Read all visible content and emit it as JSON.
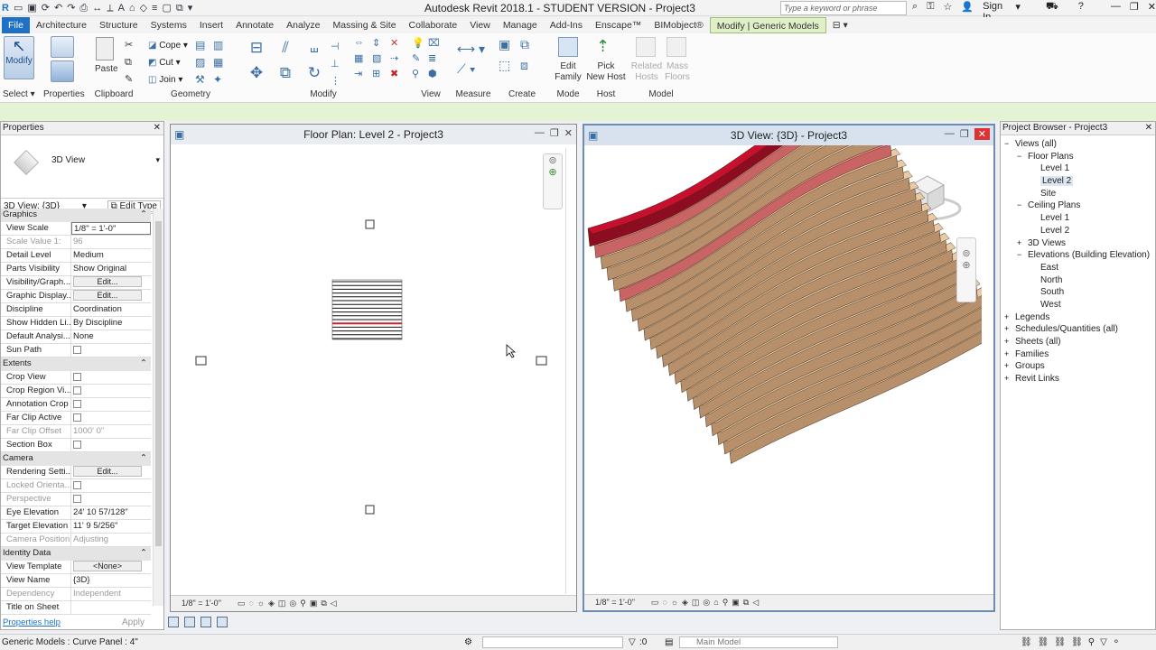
{
  "app": {
    "title": "Autodesk Revit 2018.1 - STUDENT VERSION -   Project3",
    "search_placeholder": "Type a keyword or phrase",
    "sign_in": "Sign In"
  },
  "tabs": [
    "File",
    "Architecture",
    "Structure",
    "Systems",
    "Insert",
    "Annotate",
    "Analyze",
    "Massing & Site",
    "Collaborate",
    "View",
    "Manage",
    "Add-Ins",
    "Enscape™",
    "BIMobject®",
    "Modify | Generic Models"
  ],
  "ribbon": {
    "modify_label": "Modify",
    "select_label": "Select",
    "panels": {
      "properties": "Properties",
      "clipboard": "Clipboard",
      "geometry": "Geometry",
      "modify": "Modify",
      "view": "View",
      "measure": "Measure",
      "create": "Create",
      "mode": "Mode",
      "host": "Host",
      "model": "Model"
    },
    "paste": "Paste",
    "cope": "Cope",
    "cut": "Cut",
    "join": "Join",
    "edit_family": "Edit\nFamily",
    "pick_new_host": "Pick\nNew Host",
    "related_hosts": "Related\nHosts",
    "mass_floors": "Mass\nFloors"
  },
  "properties": {
    "title": "Properties",
    "type": "3D View",
    "view_selector": "3D View: {3D}",
    "edit_type": "Edit Type",
    "groups": [
      {
        "name": "Graphics",
        "rows": [
          [
            "View Scale",
            "1/8\" = 1'-0\""
          ],
          [
            "Scale Value    1:",
            "96"
          ],
          [
            "Detail Level",
            "Medium"
          ],
          [
            "Parts Visibility",
            "Show Original"
          ],
          [
            "Visibility/Graph...",
            "Edit..."
          ],
          [
            "Graphic Display...",
            "Edit..."
          ],
          [
            "Discipline",
            "Coordination"
          ],
          [
            "Show Hidden Li...",
            "By Discipline"
          ],
          [
            "Default Analysi...",
            "None"
          ],
          [
            "Sun Path",
            ""
          ]
        ]
      },
      {
        "name": "Extents",
        "rows": [
          [
            "Crop View",
            ""
          ],
          [
            "Crop Region Vi...",
            ""
          ],
          [
            "Annotation Crop",
            ""
          ],
          [
            "Far Clip Active",
            ""
          ],
          [
            "Far Clip Offset",
            "1000'  0\""
          ],
          [
            "Section Box",
            ""
          ]
        ]
      },
      {
        "name": "Camera",
        "rows": [
          [
            "Rendering Setti...",
            "Edit..."
          ],
          [
            "Locked Orienta...",
            ""
          ],
          [
            "Perspective",
            ""
          ],
          [
            "Eye Elevation",
            "24'  10 57/128\""
          ],
          [
            "Target Elevation",
            "11'  9 5/256\""
          ],
          [
            "Camera Position",
            "Adjusting"
          ]
        ]
      },
      {
        "name": "Identity Data",
        "rows": [
          [
            "View Template",
            "<None>"
          ],
          [
            "View Name",
            "{3D}"
          ],
          [
            "Dependency",
            "Independent"
          ],
          [
            "Title on Sheet",
            ""
          ]
        ]
      }
    ],
    "help": "Properties help",
    "apply": "Apply"
  },
  "floor_view": {
    "title": "Floor Plan: Level 2 - Project3",
    "scale": "1/8\" = 1'-0\""
  },
  "view3d": {
    "title": "3D View: {3D} - Project3",
    "scale": "1/8\" = 1'-0\""
  },
  "browser": {
    "title": "Project Browser - Project3",
    "items": [
      {
        "label": "Views (all)",
        "depth": 0
      },
      {
        "label": "Floor Plans",
        "depth": 1
      },
      {
        "label": "Level 1",
        "depth": 2
      },
      {
        "label": "Level 2",
        "depth": 2
      },
      {
        "label": "Site",
        "depth": 2
      },
      {
        "label": "Ceiling Plans",
        "depth": 1
      },
      {
        "label": "Level 1",
        "depth": 2
      },
      {
        "label": "Level 2",
        "depth": 2
      },
      {
        "label": "3D Views",
        "depth": 1
      },
      {
        "label": "Elevations (Building Elevation)",
        "depth": 1
      },
      {
        "label": "East",
        "depth": 2
      },
      {
        "label": "North",
        "depth": 2
      },
      {
        "label": "South",
        "depth": 2
      },
      {
        "label": "West",
        "depth": 2
      },
      {
        "label": "Legends",
        "depth": 0
      },
      {
        "label": "Schedules/Quantities (all)",
        "depth": 0
      },
      {
        "label": "Sheets (all)",
        "depth": 0
      },
      {
        "label": "Families",
        "depth": 0
      },
      {
        "label": "Groups",
        "depth": 0
      },
      {
        "label": "Revit Links",
        "depth": 0
      }
    ]
  },
  "status": {
    "text": "Generic Models : Curve Panel : 4\"",
    "zero": ":0",
    "model": "Main Model"
  },
  "colors": {
    "file_tab": "#1e71c4",
    "context_tab": "#dff0c8",
    "selection_red": "#d0202f",
    "wood": "#e9c9a6"
  }
}
